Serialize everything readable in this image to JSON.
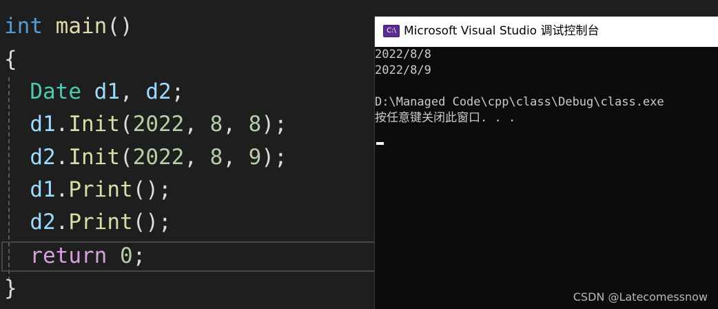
{
  "editor": {
    "lines": [
      {
        "tokens": [
          "int",
          "main",
          "()"
        ]
      },
      {
        "tokens": [
          "{"
        ]
      },
      {
        "tokens": [
          "Date",
          "d1",
          ",",
          "d2",
          ";"
        ]
      },
      {
        "tokens": [
          "d1",
          ".",
          "Init",
          "(",
          "2022",
          ",",
          "8",
          ",",
          "8",
          ");"
        ]
      },
      {
        "tokens": [
          "d2",
          ".",
          "Init",
          "(",
          "2022",
          ",",
          "8",
          ",",
          "9",
          ");"
        ]
      },
      {
        "tokens": [
          "d1",
          ".",
          "Print",
          "();"
        ]
      },
      {
        "tokens": [
          "d2",
          ".",
          "Print",
          "();"
        ]
      },
      {
        "tokens": [
          "return",
          "0",
          ";"
        ]
      },
      {
        "tokens": [
          "}"
        ]
      }
    ]
  },
  "console": {
    "icon_text": "C:\\",
    "title": "Microsoft Visual Studio 调试控制台",
    "output_lines": [
      "2022/8/8",
      "2022/8/9",
      "",
      "D:\\Managed Code\\cpp\\class\\Debug\\class.exe",
      "按任意键关闭此窗口. . ."
    ]
  },
  "watermark": "CSDN @Latecomessnow",
  "colors": {
    "editor_bg": "#1e1e1e",
    "keyword": "#569cd6",
    "control_keyword": "#d8a0df",
    "function": "#dcdcaa",
    "type": "#4ec9b0",
    "variable": "#9cdcfe",
    "number": "#b5cea8",
    "console_bg": "#0c0c0c"
  }
}
